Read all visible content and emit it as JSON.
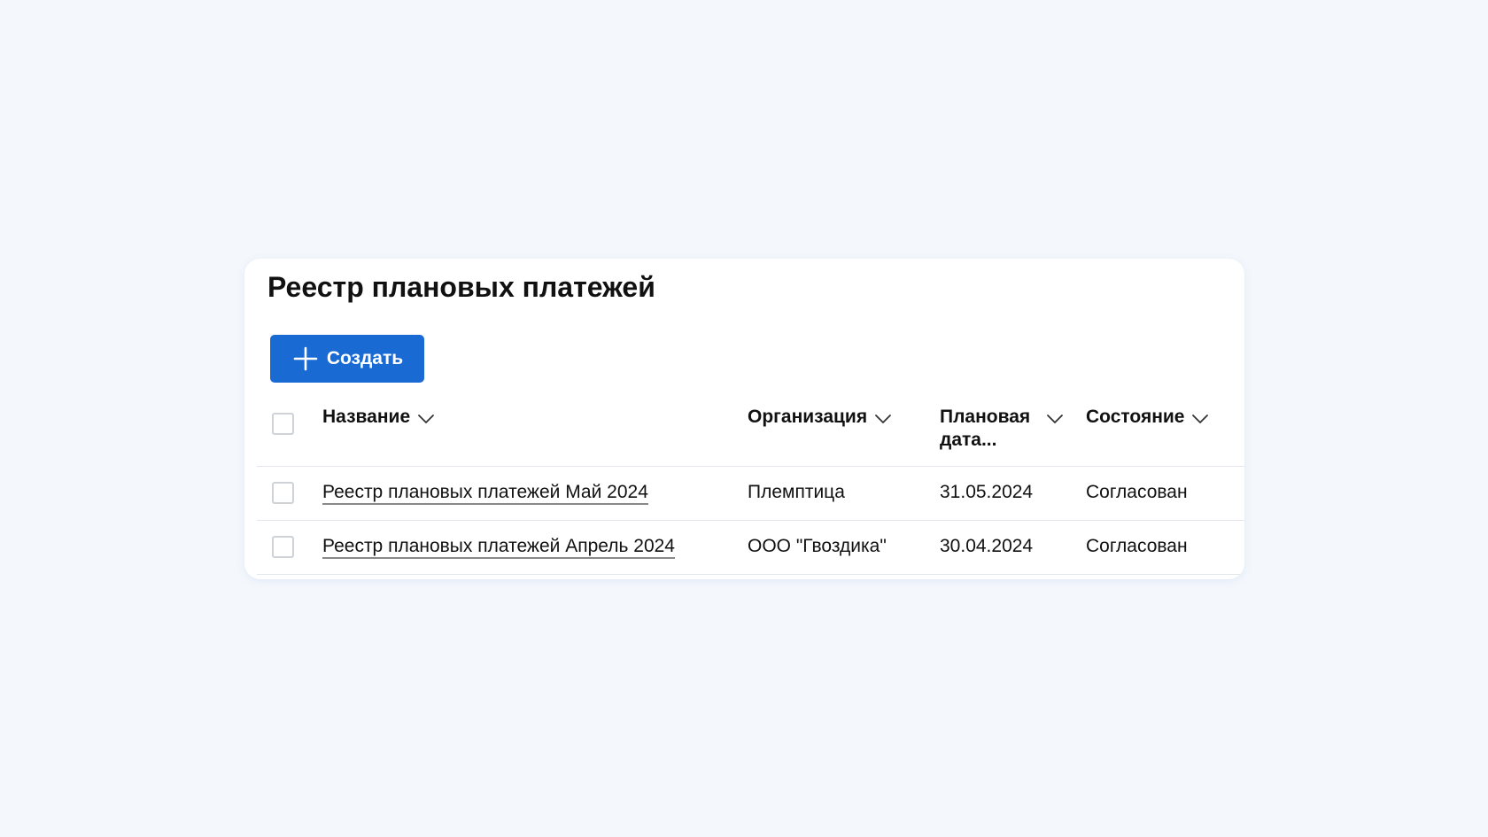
{
  "page": {
    "title": "Реестр плановых платежей"
  },
  "toolbar": {
    "create_label": "Создать",
    "create_icon": "plus-icon",
    "accent_color": "#1a6ad3"
  },
  "table": {
    "columns": [
      {
        "label": "Название",
        "sort_icon": "chevron-down-icon"
      },
      {
        "label": "Организация",
        "sort_icon": "chevron-down-icon"
      },
      {
        "label": "Плановая дата...",
        "sort_icon": "chevron-down-icon"
      },
      {
        "label": "Состояние",
        "sort_icon": "chevron-down-icon"
      }
    ],
    "rows": [
      {
        "name": "Реестр плановых платежей Май 2024",
        "organization": "Племптица",
        "date": "31.05.2024",
        "state": "Согласован",
        "selected": false
      },
      {
        "name": "Реестр плановых платежей Апрель 2024",
        "organization": "ООО \"Гвоздика\"",
        "date": "30.04.2024",
        "state": "Согласован",
        "selected": false
      }
    ]
  }
}
